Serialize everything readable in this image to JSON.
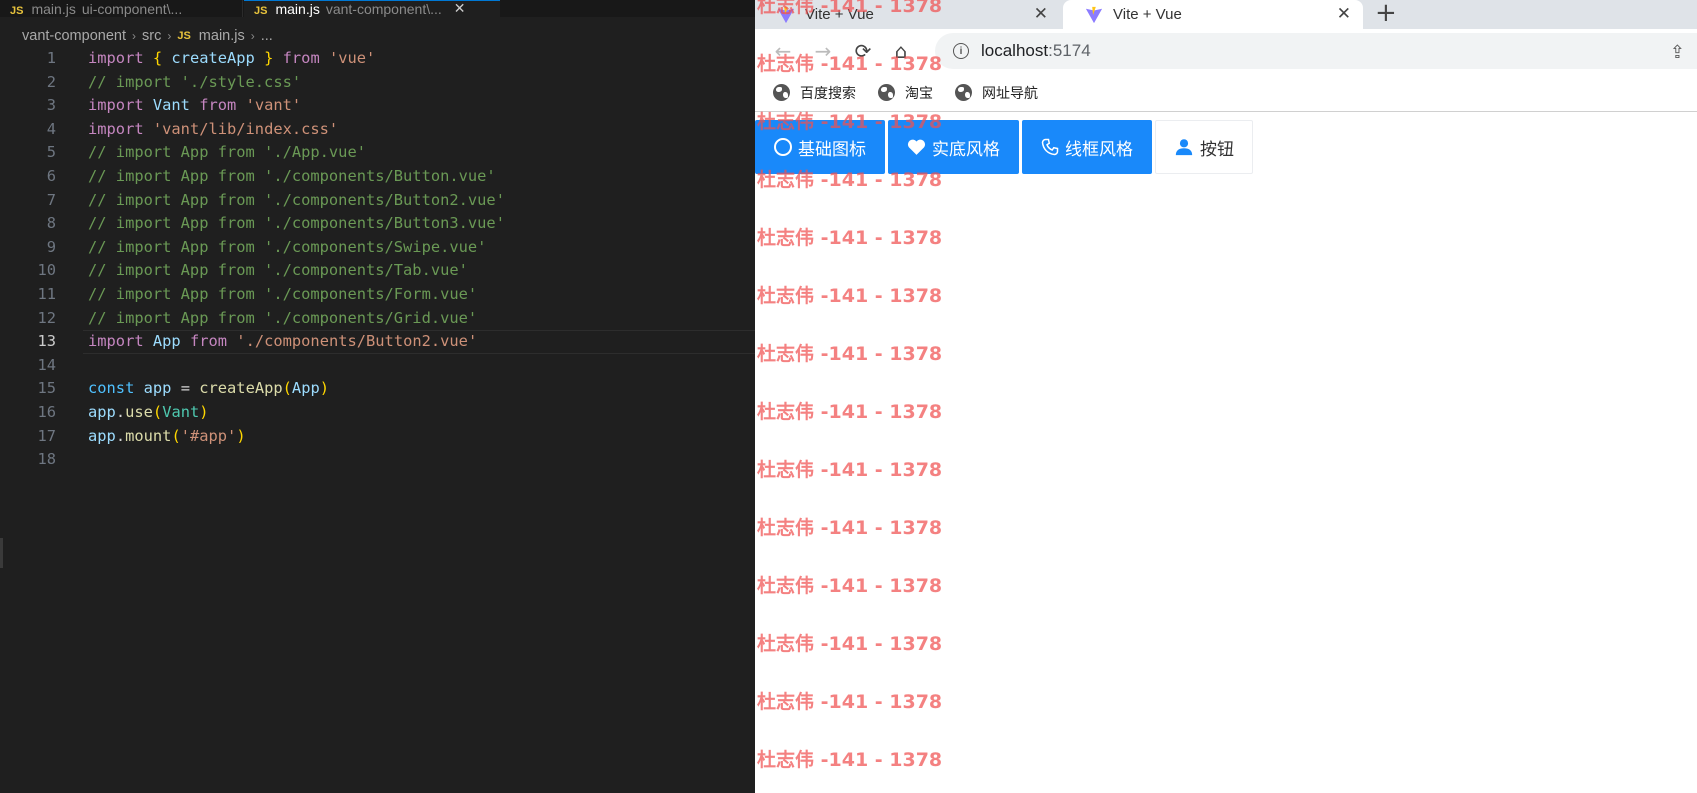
{
  "editor": {
    "tabs": [
      {
        "file": "main.js",
        "folder": "ui-component\\...",
        "active": false
      },
      {
        "file": "main.js",
        "folder": "vant-component\\...",
        "active": true
      }
    ],
    "breadcrumb": [
      "vant-component",
      "src",
      "main.js",
      "..."
    ],
    "lines": [
      {
        "n": "1",
        "tokens": [
          [
            "kw",
            "import "
          ],
          [
            "brace",
            "{ "
          ],
          [
            "var",
            "createApp"
          ],
          [
            "brace",
            " }"
          ],
          [
            "kw",
            " from "
          ],
          [
            "str",
            "'vue'"
          ]
        ]
      },
      {
        "n": "2",
        "tokens": [
          [
            "com",
            "// import './style.css'"
          ]
        ]
      },
      {
        "n": "3",
        "tokens": [
          [
            "kw",
            "import "
          ],
          [
            "var",
            "Vant"
          ],
          [
            "kw",
            " from "
          ],
          [
            "str",
            "'vant'"
          ]
        ]
      },
      {
        "n": "4",
        "tokens": [
          [
            "kw",
            "import "
          ],
          [
            "str",
            "'vant/lib/index.css'"
          ]
        ]
      },
      {
        "n": "5",
        "tokens": [
          [
            "com",
            "// import App from './App.vue'"
          ]
        ]
      },
      {
        "n": "6",
        "tokens": [
          [
            "com",
            "// import App from './components/Button.vue'"
          ]
        ]
      },
      {
        "n": "7",
        "tokens": [
          [
            "com",
            "// import App from './components/Button2.vue'"
          ]
        ]
      },
      {
        "n": "8",
        "tokens": [
          [
            "com",
            "// import App from './components/Button3.vue'"
          ]
        ]
      },
      {
        "n": "9",
        "tokens": [
          [
            "com",
            "// import App from './components/Swipe.vue'"
          ]
        ]
      },
      {
        "n": "10",
        "tokens": [
          [
            "com",
            "// import App from './components/Tab.vue'"
          ]
        ]
      },
      {
        "n": "11",
        "tokens": [
          [
            "com",
            "// import App from './components/Form.vue'"
          ]
        ]
      },
      {
        "n": "12",
        "tokens": [
          [
            "com",
            "// import App from './components/Grid.vue'"
          ]
        ]
      },
      {
        "n": "13",
        "active": true,
        "tokens": [
          [
            "kw",
            "import "
          ],
          [
            "var",
            "App"
          ],
          [
            "kw",
            " from "
          ],
          [
            "str",
            "'./components/Button2.vue'"
          ]
        ]
      },
      {
        "n": "14",
        "tokens": []
      },
      {
        "n": "15",
        "tokens": [
          [
            "blue",
            "const "
          ],
          [
            "var",
            "app"
          ],
          [
            "plain",
            " = "
          ],
          [
            "fn",
            "createApp"
          ],
          [
            "brace",
            "("
          ],
          [
            "var",
            "App"
          ],
          [
            "brace",
            ")"
          ]
        ]
      },
      {
        "n": "16",
        "tokens": [
          [
            "var",
            "app"
          ],
          [
            "plain",
            "."
          ],
          [
            "fn",
            "use"
          ],
          [
            "brace",
            "("
          ],
          [
            "cls",
            "Vant"
          ],
          [
            "brace",
            ")"
          ]
        ]
      },
      {
        "n": "17",
        "tokens": [
          [
            "var",
            "app"
          ],
          [
            "plain",
            "."
          ],
          [
            "fn",
            "mount"
          ],
          [
            "brace",
            "("
          ],
          [
            "str",
            "'#app'"
          ],
          [
            "brace",
            ")"
          ]
        ]
      },
      {
        "n": "18",
        "tokens": []
      }
    ]
  },
  "browser": {
    "tabs": [
      {
        "title": "Vite + Vue",
        "close": "✕"
      },
      {
        "title": "Vite + Vue",
        "close": "✕"
      }
    ],
    "new_tab": "+",
    "url_host": "localhost",
    "url_port": ":5174",
    "bookmarks": [
      "百度搜索",
      "淘宝",
      "网址导航"
    ],
    "buttons": [
      {
        "label": "基础图标",
        "icon": "circle-icon",
        "type": "primary"
      },
      {
        "label": "实底风格",
        "icon": "heart-icon",
        "type": "primary"
      },
      {
        "label": "线框风格",
        "icon": "phone-icon",
        "type": "primary"
      },
      {
        "label": "按钮",
        "icon": "user-icon",
        "type": "plain"
      }
    ],
    "accent_color": "#1989fa"
  },
  "watermark": {
    "text": "杜志伟 -141 - 1378",
    "count": 14,
    "color": "#f05050"
  }
}
